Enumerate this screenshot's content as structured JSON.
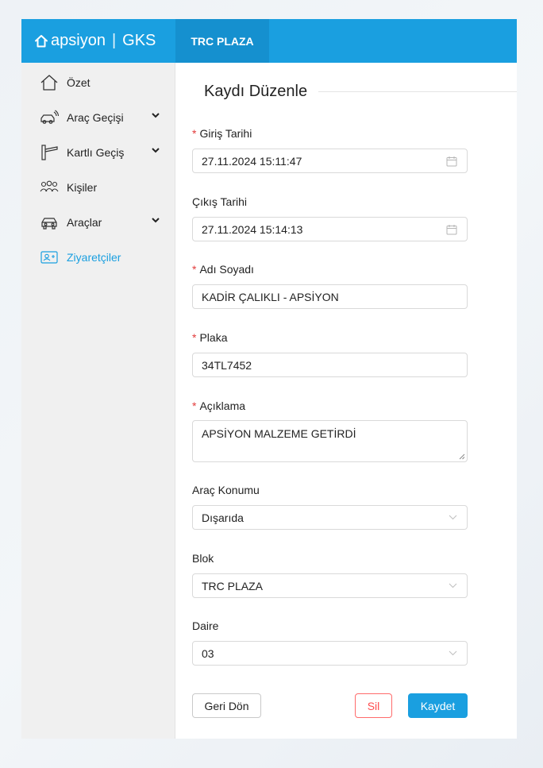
{
  "brand": {
    "name": "apsiyon",
    "separator": "|",
    "product": "GKS"
  },
  "top_tab": "TRC PLAZA",
  "sidebar": {
    "items": [
      {
        "label": "Özet",
        "icon": "home-icon"
      },
      {
        "label": "Araç Geçişi",
        "icon": "car-pass-icon",
        "expandable": true
      },
      {
        "label": "Kartlı Geçiş",
        "icon": "barrier-gate-icon",
        "expandable": true
      },
      {
        "label": "Kişiler",
        "icon": "people-icon"
      },
      {
        "label": "Araçlar",
        "icon": "car-icon",
        "expandable": true
      },
      {
        "label": "Ziyaretçiler",
        "icon": "visitor-card-icon",
        "active": true
      }
    ]
  },
  "form": {
    "title": "Kaydı Düzenle",
    "required_mark": "*",
    "giris_tarihi": {
      "label": "Giriş Tarihi",
      "value": "27.11.2024 15:11:47"
    },
    "cikis_tarihi": {
      "label": "Çıkış Tarihi",
      "value": "27.11.2024 15:14:13"
    },
    "adi_soyadi": {
      "label": "Adı Soyadı",
      "value": "KADİR ÇALIKLI - APSİYON"
    },
    "plaka": {
      "label": "Plaka",
      "value": "34TL7452"
    },
    "aciklama": {
      "label": "Açıklama",
      "value": "APSİYON MALZEME GETİRDİ"
    },
    "arac_konumu": {
      "label": "Araç Konumu",
      "value": "Dışarıda"
    },
    "blok": {
      "label": "Blok",
      "value": "TRC PLAZA"
    },
    "daire": {
      "label": "Daire",
      "value": "03"
    }
  },
  "buttons": {
    "back": "Geri Dön",
    "delete": "Sil",
    "save": "Kaydet"
  },
  "colors": {
    "primary": "#1a9fe0",
    "danger": "#ff4d4f",
    "sidebar_bg": "#f0f0f0"
  }
}
